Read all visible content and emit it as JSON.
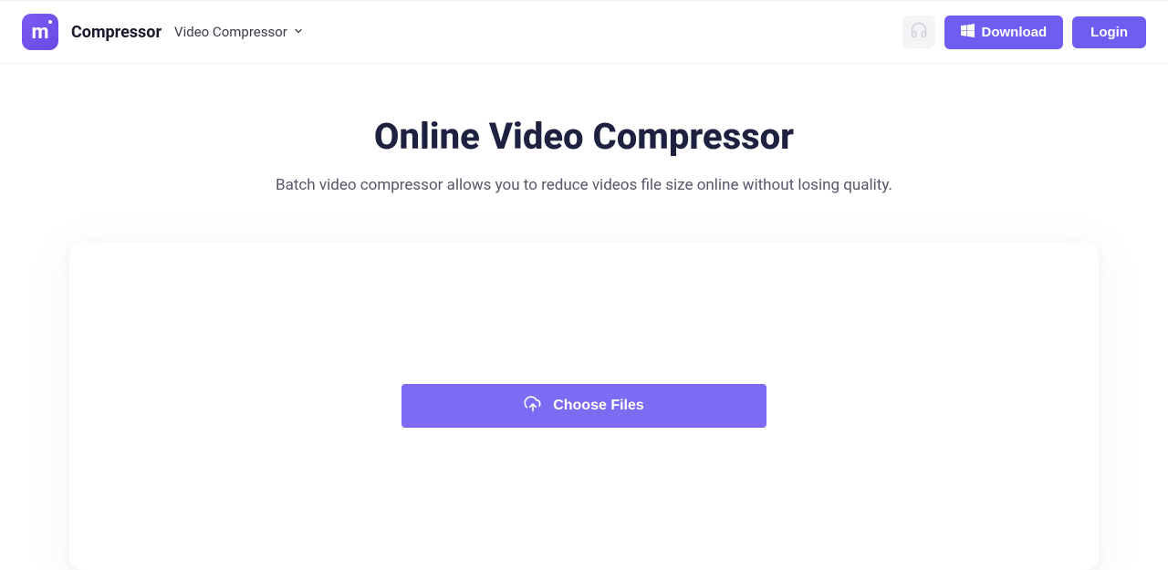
{
  "header": {
    "brand": "Compressor",
    "nav_label": "Video Compressor",
    "download_label": "Download",
    "login_label": "Login"
  },
  "main": {
    "title": "Online Video Compressor",
    "subtitle": "Batch video compressor allows you to reduce videos file size online without losing quality.",
    "choose_files_label": "Choose Files"
  }
}
